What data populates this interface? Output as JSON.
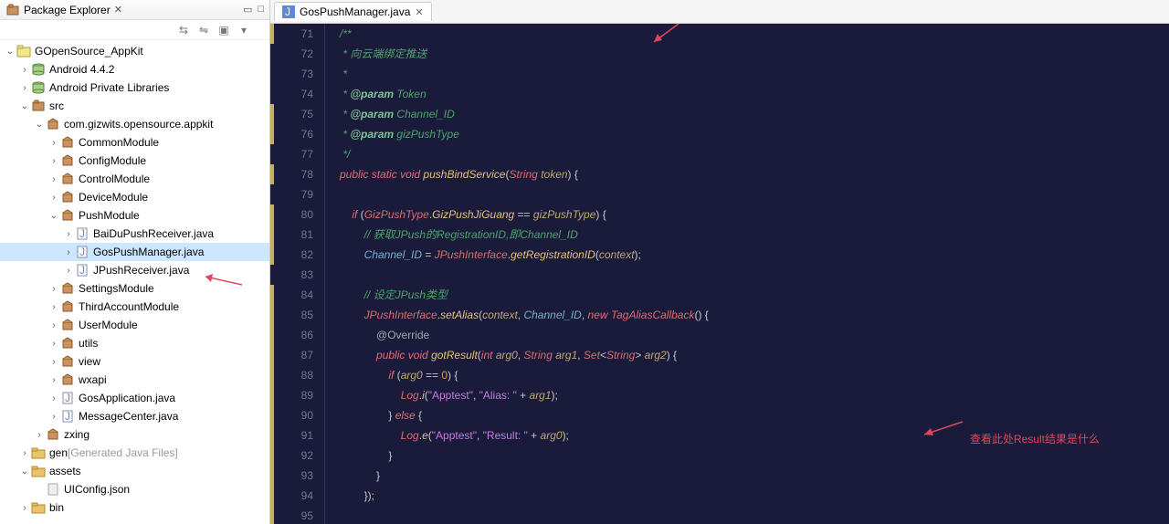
{
  "sidebar": {
    "title": "Package Explorer",
    "tree": [
      {
        "d": 0,
        "exp": "open",
        "icon": "proj",
        "label": "GOpenSource_AppKit"
      },
      {
        "d": 1,
        "exp": "closed",
        "icon": "lib",
        "label": "Android 4.4.2"
      },
      {
        "d": 1,
        "exp": "closed",
        "icon": "lib",
        "label": "Android Private Libraries"
      },
      {
        "d": 1,
        "exp": "open",
        "icon": "src",
        "label": "src"
      },
      {
        "d": 2,
        "exp": "open",
        "icon": "package",
        "label": "com.gizwits.opensource.appkit"
      },
      {
        "d": 3,
        "exp": "closed",
        "icon": "package",
        "label": "CommonModule"
      },
      {
        "d": 3,
        "exp": "closed",
        "icon": "package",
        "label": "ConfigModule"
      },
      {
        "d": 3,
        "exp": "closed",
        "icon": "package",
        "label": "ControlModule"
      },
      {
        "d": 3,
        "exp": "closed",
        "icon": "package",
        "label": "DeviceModule"
      },
      {
        "d": 3,
        "exp": "open",
        "icon": "package",
        "label": "PushModule"
      },
      {
        "d": 4,
        "exp": "closed",
        "icon": "java",
        "label": "BaiDuPushReceiver.java"
      },
      {
        "d": 4,
        "exp": "closed",
        "icon": "java",
        "label": "GosPushManager.java",
        "selected": true
      },
      {
        "d": 4,
        "exp": "closed",
        "icon": "java",
        "label": "JPushReceiver.java"
      },
      {
        "d": 3,
        "exp": "closed",
        "icon": "package",
        "label": "SettingsModule"
      },
      {
        "d": 3,
        "exp": "closed",
        "icon": "package",
        "label": "ThirdAccountModule"
      },
      {
        "d": 3,
        "exp": "closed",
        "icon": "package",
        "label": "UserModule"
      },
      {
        "d": 3,
        "exp": "closed",
        "icon": "package",
        "label": "utils"
      },
      {
        "d": 3,
        "exp": "closed",
        "icon": "package",
        "label": "view"
      },
      {
        "d": 3,
        "exp": "closed",
        "icon": "package",
        "label": "wxapi"
      },
      {
        "d": 3,
        "exp": "closed",
        "icon": "java",
        "label": "GosApplication.java"
      },
      {
        "d": 3,
        "exp": "closed",
        "icon": "java",
        "label": "MessageCenter.java"
      },
      {
        "d": 2,
        "exp": "closed",
        "icon": "package",
        "label": "zxing"
      },
      {
        "d": 1,
        "exp": "closed",
        "icon": "folder",
        "label": "gen",
        "suffix": "[Generated Java Files]"
      },
      {
        "d": 1,
        "exp": "open",
        "icon": "folder",
        "label": "assets"
      },
      {
        "d": 2,
        "exp": "none",
        "icon": "file",
        "label": "UIConfig.json"
      },
      {
        "d": 1,
        "exp": "closed",
        "icon": "folder",
        "label": "bin"
      }
    ]
  },
  "editor": {
    "tab_label": "GosPushManager.java",
    "first_line": 71,
    "lines": [
      {
        "dirty": true,
        "html": "/**"
      },
      {
        "html": " * 向云端绑定推送"
      },
      {
        "html": " * "
      },
      {
        "html": " * @param Token"
      },
      {
        "dirty": true,
        "html": " * @param Channel_ID"
      },
      {
        "dirty": true,
        "html": " * @param gizPushType"
      },
      {
        "html": " */"
      },
      {
        "dirty": true,
        "html": "public static void pushBindService(String token) {"
      },
      {
        "html": ""
      },
      {
        "dirty": true,
        "html": "    if (GizPushType.GizPushJiGuang == gizPushType) {"
      },
      {
        "dirty": true,
        "html": "        // 获取JPush的RegistrationID,即Channel_ID"
      },
      {
        "dirty": true,
        "html": "        Channel_ID = JPushInterface.getRegistrationID(context);"
      },
      {
        "html": ""
      },
      {
        "dirty": true,
        "html": "        // 设定JPush类型"
      },
      {
        "dirty": true,
        "html": "        JPushInterface.setAlias(context, Channel_ID, new TagAliasCallback() {"
      },
      {
        "dirty": true,
        "html": "            @Override"
      },
      {
        "dirty": true,
        "html": "            public void gotResult(int arg0, String arg1, Set<String> arg2) {"
      },
      {
        "dirty": true,
        "html": "                if (arg0 == 0) {"
      },
      {
        "dirty": true,
        "html": "                    Log.i(\"Apptest\", \"Alias: \" + arg1);"
      },
      {
        "dirty": true,
        "html": "                } else {"
      },
      {
        "dirty": true,
        "html": "                    Log.e(\"Apptest\", \"Result: \" + arg0);"
      },
      {
        "dirty": true,
        "html": "                }"
      },
      {
        "dirty": true,
        "html": "            }"
      },
      {
        "dirty": true,
        "html": "        });"
      },
      {
        "dirty": true,
        "html": ""
      }
    ],
    "annotation_text": "查看此处Result结果是什么"
  }
}
